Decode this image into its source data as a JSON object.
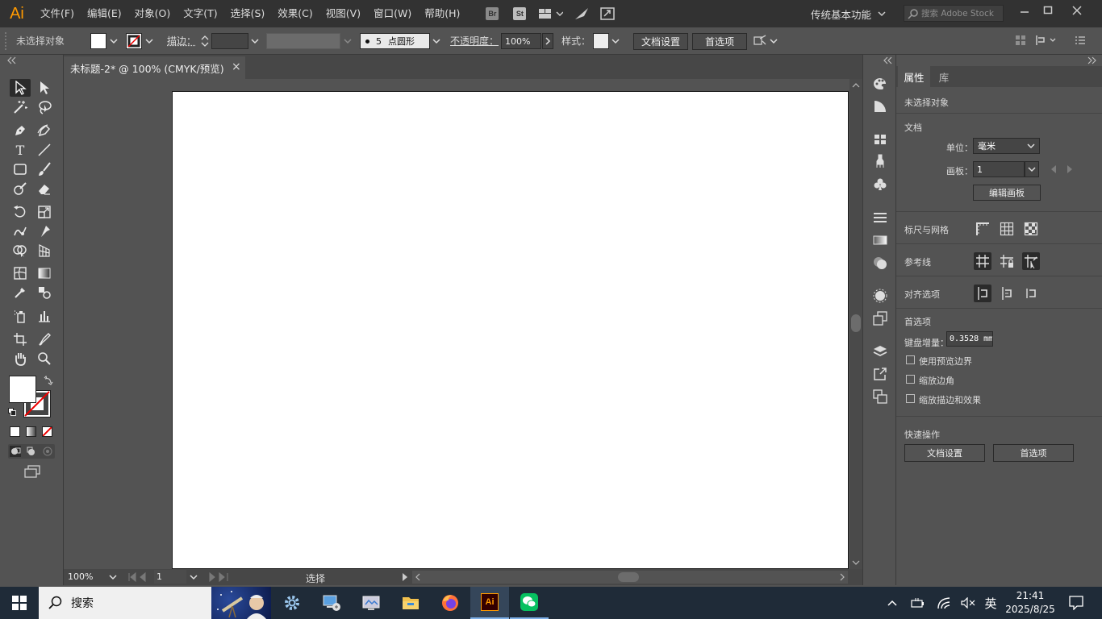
{
  "app": {
    "logo": "Ai"
  },
  "menu": [
    "文件(F)",
    "编辑(E)",
    "对象(O)",
    "文字(T)",
    "选择(S)",
    "效果(C)",
    "视图(V)",
    "窗口(W)",
    "帮助(H)"
  ],
  "menu_icons": {
    "bridge": "Br",
    "stock": "St"
  },
  "workspace": "传统基本功能",
  "stock_search": {
    "placeholder": "搜索 Adobe Stock"
  },
  "control_bar": {
    "selection": "未选择对象",
    "stroke_label": "描边：",
    "brush_size": "5",
    "brush_name": "点圆形",
    "opacity_label": "不透明度：",
    "opacity_value": "100%",
    "style_label": "样式：",
    "doc_setup": "文档设置",
    "preferences": "首选项"
  },
  "document_tab": {
    "title": "未标题-2* @ 100% (CMYK/预览)",
    "close": "×"
  },
  "status_bar": {
    "zoom": "100%",
    "artboard": "1",
    "tool": "选择"
  },
  "properties": {
    "tabs": [
      "属性",
      "库"
    ],
    "no_selection": "未选择对象",
    "document_header": "文档",
    "units_label": "单位：",
    "units_value": "毫米",
    "artboard_label": "画板：",
    "artboard_value": "1",
    "edit_artboards": "编辑画板",
    "rulers_grids": "标尺与网格",
    "guides": "参考线",
    "snap_options": "对齐选项",
    "preferences_header": "首选项",
    "keyboard_increment_label": "键盘增量：",
    "keyboard_increment_value": "0.3528 mm",
    "use_preview_bounds": "使用预览边界",
    "scale_corners": "缩放边角",
    "scale_strokes_effects": "缩放描边和效果",
    "quick_actions": "快速操作",
    "qa_doc_setup": "文档设置",
    "qa_preferences": "首选项"
  },
  "taskbar": {
    "search": "搜索",
    "time": "21:41",
    "date": "2025/8/25",
    "ime": "英"
  },
  "colors": {
    "accent": "#ff9a00",
    "ui_dark": "#323232",
    "ui_mid": "#535353",
    "taskbar": "#1f2b38"
  }
}
